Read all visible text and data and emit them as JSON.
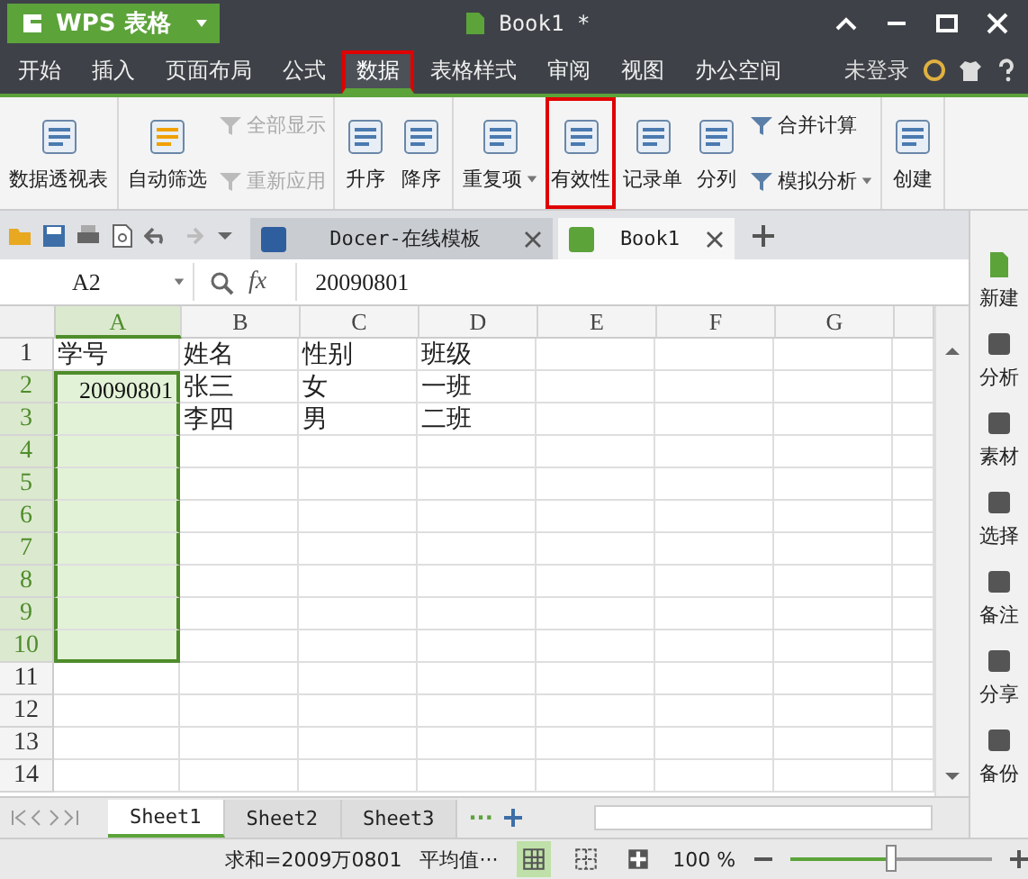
{
  "app_button": {
    "label": "WPS 表格"
  },
  "window": {
    "title": "Book1 *"
  },
  "menu_tabs": [
    {
      "label": "开始",
      "selected": false,
      "highlighted": false
    },
    {
      "label": "插入",
      "selected": false,
      "highlighted": false
    },
    {
      "label": "页面布局",
      "selected": false,
      "highlighted": false
    },
    {
      "label": "公式",
      "selected": false,
      "highlighted": false
    },
    {
      "label": "数据",
      "selected": true,
      "highlighted": true
    },
    {
      "label": "表格样式",
      "selected": false,
      "highlighted": false
    },
    {
      "label": "审阅",
      "selected": false,
      "highlighted": false
    },
    {
      "label": "视图",
      "selected": false,
      "highlighted": false
    },
    {
      "label": "办公空间",
      "selected": false,
      "highlighted": false
    }
  ],
  "login": {
    "label": "未登录"
  },
  "ribbon_groups": [
    {
      "buttons": [
        {
          "kind": "large",
          "label": "数据透视表",
          "disabled": false,
          "highlighted": false,
          "dropdown": false
        }
      ]
    },
    {
      "buttons": [
        {
          "kind": "large",
          "label": "自动筛选",
          "disabled": false,
          "highlighted": false,
          "dropdown": false
        },
        {
          "kind": "small",
          "label": "全部显示",
          "disabled": true,
          "highlighted": false,
          "dropdown": false
        },
        {
          "kind": "small",
          "label": "重新应用",
          "disabled": true,
          "highlighted": false,
          "dropdown": false
        }
      ]
    },
    {
      "buttons": [
        {
          "kind": "large",
          "label": "升序",
          "disabled": false,
          "highlighted": false,
          "dropdown": false
        },
        {
          "kind": "large",
          "label": "降序",
          "disabled": false,
          "highlighted": false,
          "dropdown": false
        }
      ]
    },
    {
      "buttons": [
        {
          "kind": "large",
          "label": "重复项",
          "disabled": false,
          "highlighted": false,
          "dropdown": true
        },
        {
          "kind": "large",
          "label": "有效性",
          "disabled": false,
          "highlighted": true,
          "dropdown": false
        },
        {
          "kind": "large",
          "label": "记录单",
          "disabled": false,
          "highlighted": false,
          "dropdown": false
        },
        {
          "kind": "large",
          "label": "分列",
          "disabled": false,
          "highlighted": false,
          "dropdown": false
        },
        {
          "kind": "small",
          "label": "合并计算",
          "disabled": false,
          "highlighted": false,
          "dropdown": false
        },
        {
          "kind": "small",
          "label": "模拟分析",
          "disabled": false,
          "highlighted": false,
          "dropdown": true
        }
      ]
    },
    {
      "buttons": [
        {
          "kind": "large",
          "label": "创建",
          "disabled": false,
          "highlighted": false,
          "dropdown": false
        }
      ]
    }
  ],
  "doc_tabs": [
    {
      "label": "Docer-在线模板",
      "selected": false
    },
    {
      "label": "Book1",
      "selected": true
    }
  ],
  "name_box": {
    "value": "A2"
  },
  "formula_bar": {
    "fx_label": "fx",
    "value": "20090801"
  },
  "columns": [
    {
      "label": "A",
      "selected": true
    },
    {
      "label": "B",
      "selected": false
    },
    {
      "label": "C",
      "selected": false
    },
    {
      "label": "D",
      "selected": false
    },
    {
      "label": "E",
      "selected": false
    },
    {
      "label": "F",
      "selected": false
    },
    {
      "label": "G",
      "selected": false
    }
  ],
  "rows": [
    {
      "label": "1",
      "selected": false,
      "cells": [
        {
          "text": "学号",
          "numeric": false
        },
        {
          "text": "姓名",
          "numeric": false
        },
        {
          "text": "性别",
          "numeric": false
        },
        {
          "text": "班级",
          "numeric": false
        }
      ]
    },
    {
      "label": "2",
      "selected": true,
      "cells": [
        {
          "text": "20090801",
          "numeric": true
        },
        {
          "text": "张三",
          "numeric": false
        },
        {
          "text": "女",
          "numeric": false
        },
        {
          "text": "一班",
          "numeric": false
        }
      ]
    },
    {
      "label": "3",
      "selected": true,
      "cells": [
        null,
        {
          "text": "李四",
          "numeric": false
        },
        {
          "text": "男",
          "numeric": false
        },
        {
          "text": "二班",
          "numeric": false
        }
      ]
    },
    {
      "label": "4",
      "selected": true,
      "cells": []
    },
    {
      "label": "5",
      "selected": true,
      "cells": []
    },
    {
      "label": "6",
      "selected": true,
      "cells": []
    },
    {
      "label": "7",
      "selected": true,
      "cells": []
    },
    {
      "label": "8",
      "selected": true,
      "cells": []
    },
    {
      "label": "9",
      "selected": true,
      "cells": []
    },
    {
      "label": "10",
      "selected": true,
      "cells": []
    },
    {
      "label": "11",
      "selected": false,
      "cells": []
    },
    {
      "label": "12",
      "selected": false,
      "cells": []
    },
    {
      "label": "13",
      "selected": false,
      "cells": []
    },
    {
      "label": "14",
      "selected": false,
      "cells": []
    }
  ],
  "sheet_tabs": [
    {
      "label": "Sheet1",
      "selected": true
    },
    {
      "label": "Sheet2",
      "selected": false
    },
    {
      "label": "Sheet3",
      "selected": false
    }
  ],
  "sheet_more": "···",
  "sidebar": [
    {
      "label": "新建"
    },
    {
      "label": "分析"
    },
    {
      "label": "素材"
    },
    {
      "label": "选择"
    },
    {
      "label": "备注"
    },
    {
      "label": "分享"
    },
    {
      "label": "备份"
    }
  ],
  "status_bar": {
    "sum": "求和=2009万0801",
    "average": "平均值···",
    "zoom": "100 %",
    "zoom_slider": {
      "level": 0.5
    }
  }
}
